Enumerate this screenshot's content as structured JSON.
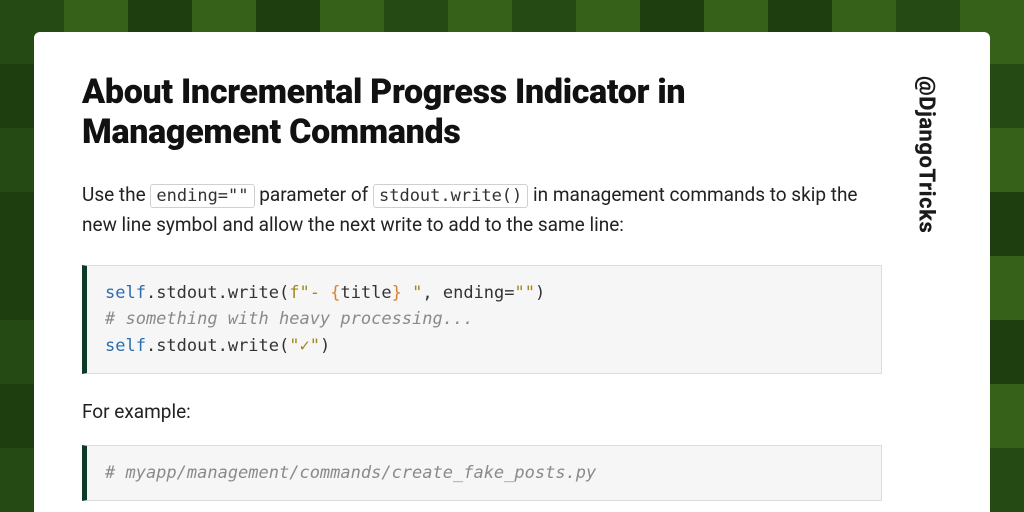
{
  "sidebar": {
    "handle": "@DjangoTricks"
  },
  "article": {
    "title": "About Incremental Progress Indicator in Management Commands",
    "intro_pre": "Use the ",
    "intro_code1": "ending=\"\"",
    "intro_mid": " parameter of ",
    "intro_code2": "stdout.write()",
    "intro_post": " in management commands to skip the new line symbol and allow the next write to add to the same line:",
    "lead2": "For example:",
    "code1": {
      "l1_self": "self",
      "l1_after_self": ".stdout.write(",
      "l1_fprefix": "f\"- ",
      "l1_lbrace": "{",
      "l1_fcontent": "title",
      "l1_rbrace": "}",
      "l1_fsuffix": " \"",
      "l1_comma": ", ",
      "l1_kwarg": "ending",
      "l1_eq": "=",
      "l1_kwval": "\"\"",
      "l1_close": ")",
      "l2_comment": "# something with heavy processing...",
      "l3_self": "self",
      "l3_after_self": ".stdout.write(",
      "l3_str": "\"✓\"",
      "l3_close": ")"
    },
    "code2": {
      "l1_comment": "# myapp/management/commands/create_fake_posts.py"
    }
  }
}
